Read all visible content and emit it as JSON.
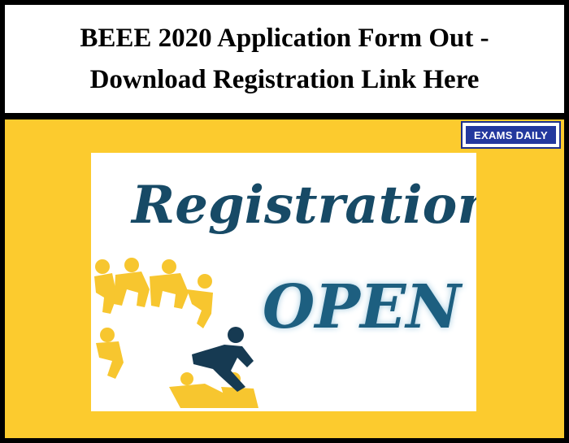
{
  "header": {
    "title_line1": "BEEE 2020 Application Form Out -",
    "title_line2": "Download Registration Link Here"
  },
  "logo": {
    "word1": "EXAMS",
    "word2": "DAILY"
  },
  "banner": {
    "headline": "Registration",
    "subheadline": "OPEN"
  },
  "colors": {
    "banner_background": "#fccb2e",
    "headline_blue": "#174a66",
    "people_yellow": "#f7c62f",
    "people_navy": "#163a52"
  }
}
